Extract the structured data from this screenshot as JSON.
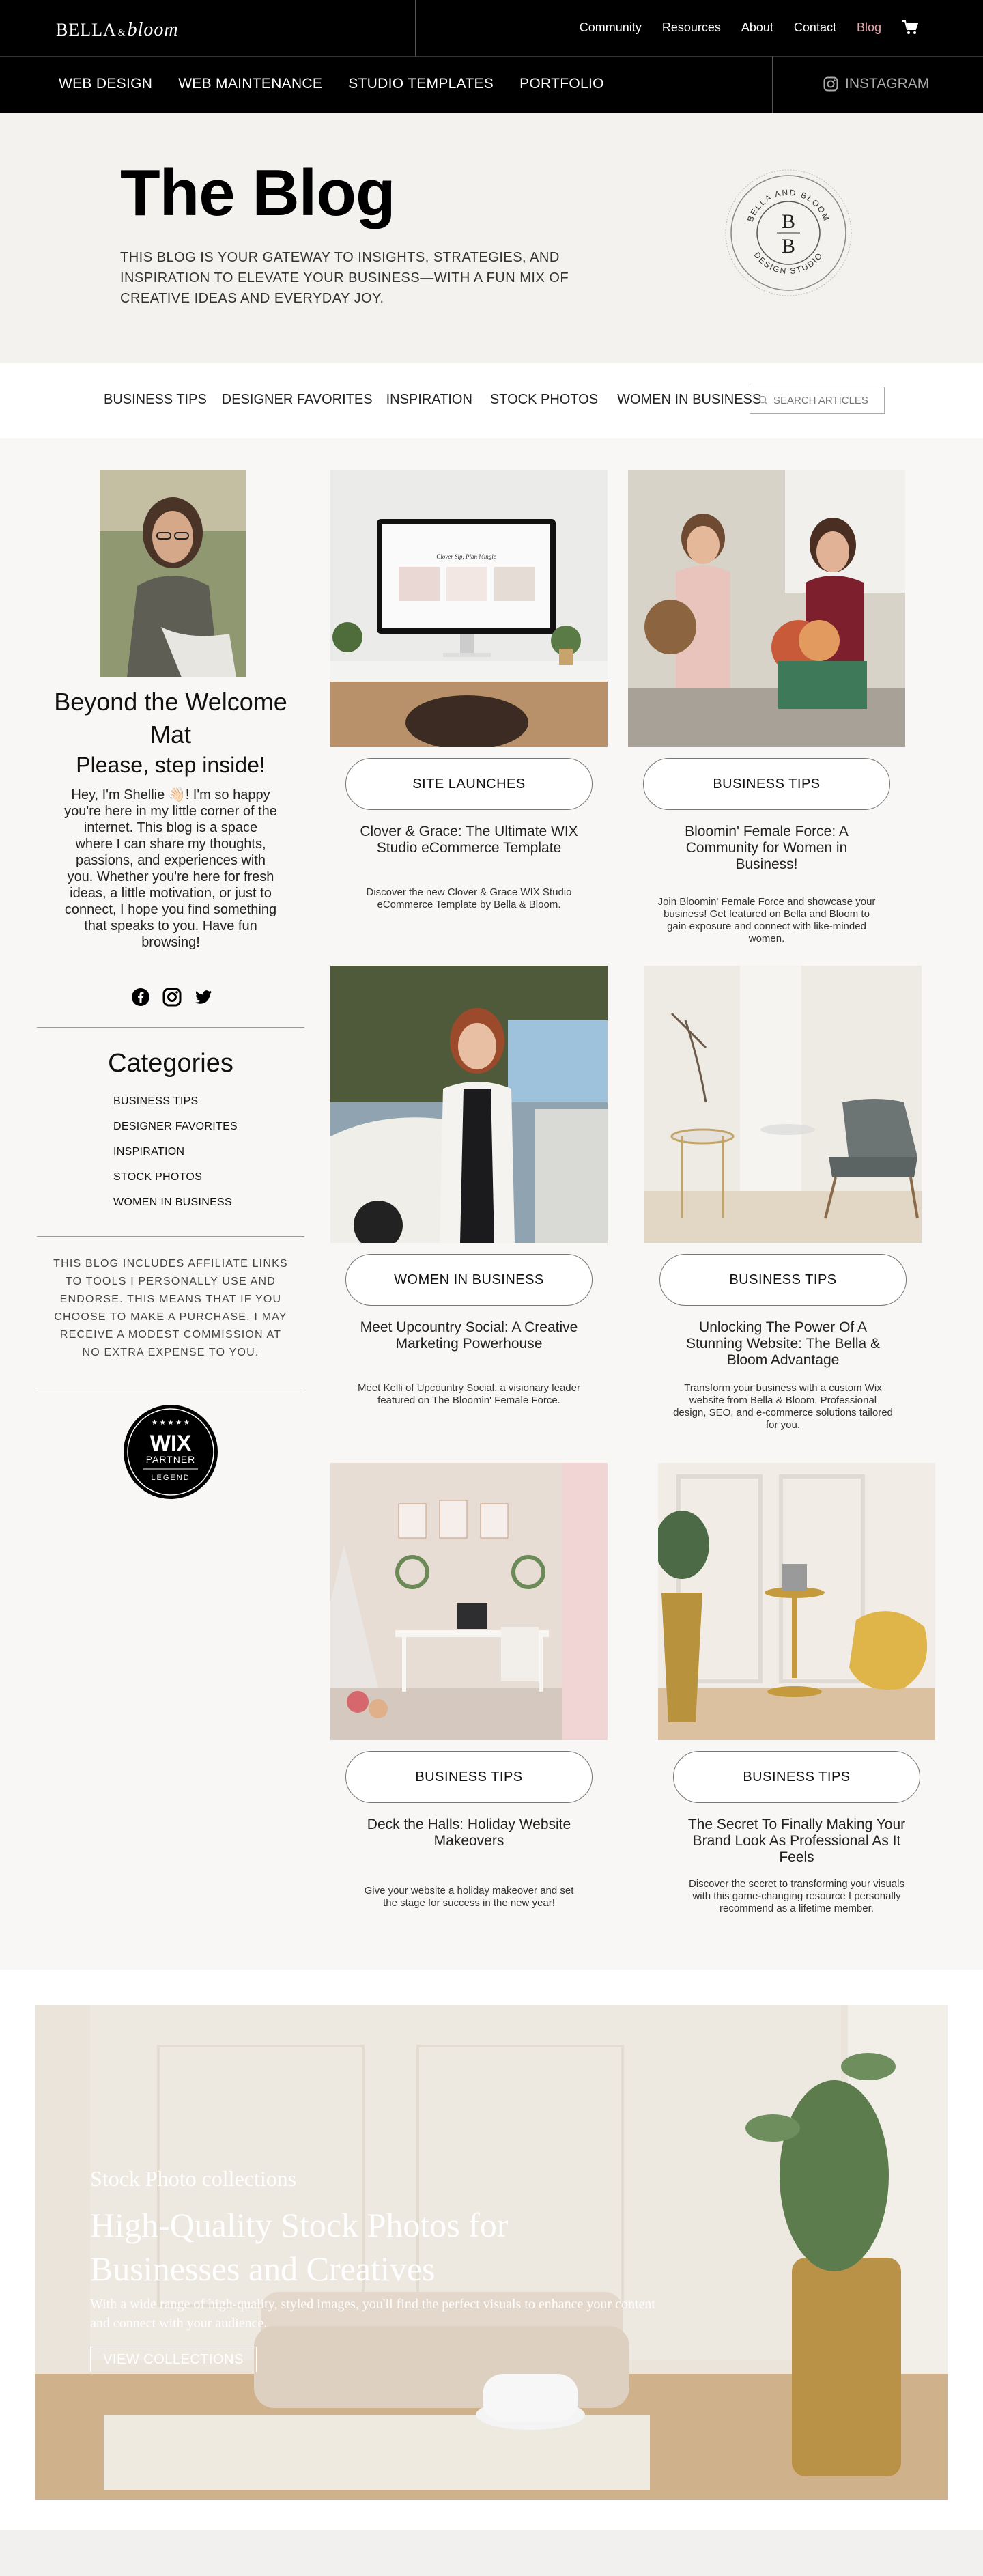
{
  "header": {
    "logo_left": "BELLA",
    "logo_right": "bloom",
    "nav": [
      "Community",
      "Resources",
      "About",
      "Contact",
      "Blog"
    ],
    "active": "Blog"
  },
  "subnav": {
    "items": [
      "WEB DESIGN",
      "WEB MAINTENANCE",
      "STUDIO TEMPLATES",
      "PORTFOLIO"
    ],
    "instagram": "INSTAGRAM"
  },
  "hero": {
    "title": "The Blog",
    "text": "THIS BLOG IS YOUR GATEWAY TO INSIGHTS, STRATEGIES, AND INSPIRATION TO ELEVATE YOUR BUSINESS—WITH A FUN MIX OF CREATIVE IDEAS AND EVERYDAY JOY.",
    "badge_top": "BELLA AND BLOOM",
    "badge_bottom": "DESIGN STUDIO",
    "badge_mono_1": "B",
    "badge_mono_2": "B"
  },
  "filters": {
    "categories": [
      "BUSINESS TIPS",
      "DESIGNER FAVORITES",
      "INSPIRATION",
      "STOCK PHOTOS",
      "WOMEN IN BUSINESS"
    ],
    "search_placeholder": "SEARCH ARTICLES"
  },
  "sidebar": {
    "title": "Beyond the Welcome Mat",
    "subtitle": "Please, step inside!",
    "text": "Hey, I'm Shellie 👋🏻! I'm so happy you're here in my little corner of the internet. This blog is a space where I can share my thoughts, passions, and experiences with you. Whether you're here for fresh ideas, a little motivation, or just to connect, I hope you find something that speaks to you. Have fun browsing!",
    "categories_title": "Categories",
    "categories": [
      "BUSINESS TIPS",
      "DESIGNER FAVORITES",
      "INSPIRATION",
      "STOCK PHOTOS",
      "WOMEN IN BUSINESS"
    ],
    "affiliate": "THIS BLOG INCLUDES AFFILIATE LINKS TO TOOLS I PERSONALLY USE AND ENDORSE. THIS MEANS THAT IF YOU CHOOSE TO MAKE A PURCHASE, I MAY RECEIVE A MODEST COMMISSION AT NO EXTRA EXPENSE TO YOU.",
    "wix_big": "WIX",
    "wix_partner": "PARTNER",
    "wix_legend": "LEGEND"
  },
  "posts": [
    {
      "category": "SITE LAUNCHES",
      "title": "Clover & Grace: The Ultimate WIX Studio eCommerce Template",
      "desc": "Discover the new Clover & Grace WIX Studio eCommerce Template by Bella & Bloom.",
      "screen_title": "Clover Sip, Plan Mingle"
    },
    {
      "category": "BUSINESS TIPS",
      "title": "Bloomin' Female Force: A Community for Women in Business!",
      "desc": "Join Bloomin' Female Force and showcase your business! Get featured on Bella and Bloom to gain exposure and connect with like-minded women."
    },
    {
      "category": "WOMEN IN BUSINESS",
      "title": "Meet Upcountry Social: A Creative Marketing Powerhouse",
      "desc": "Meet Kelli of Upcountry Social, a visionary leader featured on The Bloomin' Female Force."
    },
    {
      "category": "BUSINESS TIPS",
      "title": "Unlocking The Power Of A Stunning Website: The Bella & Bloom Advantage",
      "desc": "Transform your business with a custom Wix website from Bella & Bloom. Professional design, SEO, and e-commerce solutions tailored for you."
    },
    {
      "category": "BUSINESS TIPS",
      "title": "Deck the Halls: Holiday Website Makeovers",
      "desc": "Give your website a holiday makeover and set the stage for success in the new year!"
    },
    {
      "category": "BUSINESS TIPS",
      "title": "The Secret To Finally Making Your Brand Look As Professional As It Feels",
      "desc": "Discover the secret to transforming your visuals with this game-changing resource I personally recommend as a lifetime member."
    }
  ],
  "banner": {
    "eyebrow": "Stock Photo collections",
    "title": "High-Quality Stock Photos for Businesses and Creatives",
    "desc": "With a wide range of high-quality, styled images, you'll find the perfect visuals to enhance your content and connect with your audience.",
    "button": "VIEW COLLECTIONS"
  },
  "colors": {
    "accent": "#e9a9ab",
    "black": "#000000",
    "bg": "#f8f7f5"
  }
}
